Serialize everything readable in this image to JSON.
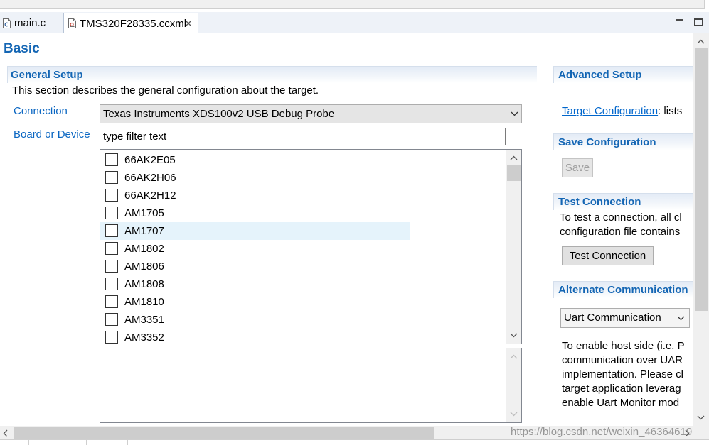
{
  "tabs": [
    {
      "label": "main.c",
      "icon": "c-file-icon",
      "active": false
    },
    {
      "label": "TMS320F28335.ccxml",
      "icon": "ccxml-file-icon",
      "active": true
    }
  ],
  "page_title": "Basic",
  "general_setup": {
    "title": "General Setup",
    "description": "This section describes the general configuration about the target.",
    "connection_label": "Connection",
    "connection_value": "Texas Instruments XDS100v2 USB Debug Probe",
    "board_label": "Board or Device",
    "filter_text": "type filter text",
    "devices": [
      {
        "label": "66AK2E05",
        "checked": false,
        "hovered": false
      },
      {
        "label": "66AK2H06",
        "checked": false,
        "hovered": false
      },
      {
        "label": "66AK2H12",
        "checked": false,
        "hovered": false
      },
      {
        "label": "AM1705",
        "checked": false,
        "hovered": false
      },
      {
        "label": "AM1707",
        "checked": false,
        "hovered": true
      },
      {
        "label": "AM1802",
        "checked": false,
        "hovered": false
      },
      {
        "label": "AM1806",
        "checked": false,
        "hovered": false
      },
      {
        "label": "AM1808",
        "checked": false,
        "hovered": false
      },
      {
        "label": "AM1810",
        "checked": false,
        "hovered": false
      },
      {
        "label": "AM3351",
        "checked": false,
        "hovered": false
      },
      {
        "label": "AM3352",
        "checked": false,
        "hovered": false
      }
    ]
  },
  "advanced_setup": {
    "title": "Advanced Setup",
    "link": "Target Configuration",
    "link_suffix": ": lists"
  },
  "save_configuration": {
    "title": "Save Configuration",
    "save_label": "Save"
  },
  "test_connection": {
    "title": "Test Connection",
    "lines": [
      "To test a connection, all cl",
      "configuration file contains"
    ],
    "button_label": "Test Connection"
  },
  "alternate_communication": {
    "title": "Alternate Communication",
    "selected": "Uart Communication",
    "lines": [
      "To enable host side (i.e. P",
      "communication over UAR",
      "implementation. Please cl",
      "target application leverag",
      "enable Uart Monitor mod"
    ]
  },
  "watermark": "https://blog.csdn.net/weixin_46364619",
  "colors": {
    "title_blue": "#1466b4",
    "label_blue": "#0a66c2",
    "link_blue": "#0066cc",
    "hover_row": "#e5f3fb"
  }
}
